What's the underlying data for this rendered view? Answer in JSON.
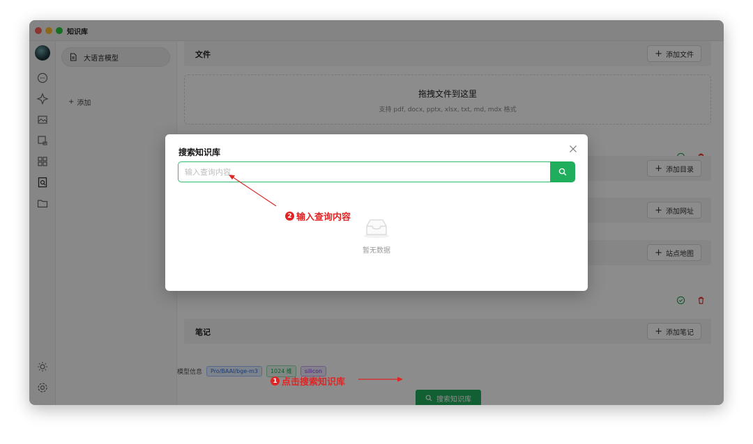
{
  "window": {
    "title": "知识库"
  },
  "kb_list": {
    "items": [
      {
        "label": "大语言模型"
      }
    ],
    "add_label": "添加"
  },
  "sections": {
    "file": {
      "title": "文件",
      "add_label": "添加文件",
      "drop_title": "拖拽文件到这里",
      "drop_hint": "支持 pdf, docx, pptx, xlsx, txt, md, mdx 格式"
    },
    "directory": {
      "add_label": "添加目录"
    },
    "url": {
      "add_label": "添加网址"
    },
    "sitemap": {
      "add_label": "站点地图"
    },
    "note": {
      "title": "笔记",
      "add_label": "添加笔记"
    }
  },
  "model_info": {
    "label": "模型信息",
    "tags": [
      "Pro/BAAI/bge-m3",
      "1024 维",
      "silicon"
    ]
  },
  "search_button_label": "搜索知识库",
  "modal": {
    "title": "搜索知识库",
    "placeholder": "输入查询内容",
    "empty_text": "暂无数据"
  },
  "annotations": [
    {
      "number": "2",
      "text": "输入查询内容"
    },
    {
      "number": "1",
      "text": "点击搜索知识库"
    }
  ],
  "colors": {
    "accent": "#1fae5b",
    "annotation": "#e02424"
  }
}
